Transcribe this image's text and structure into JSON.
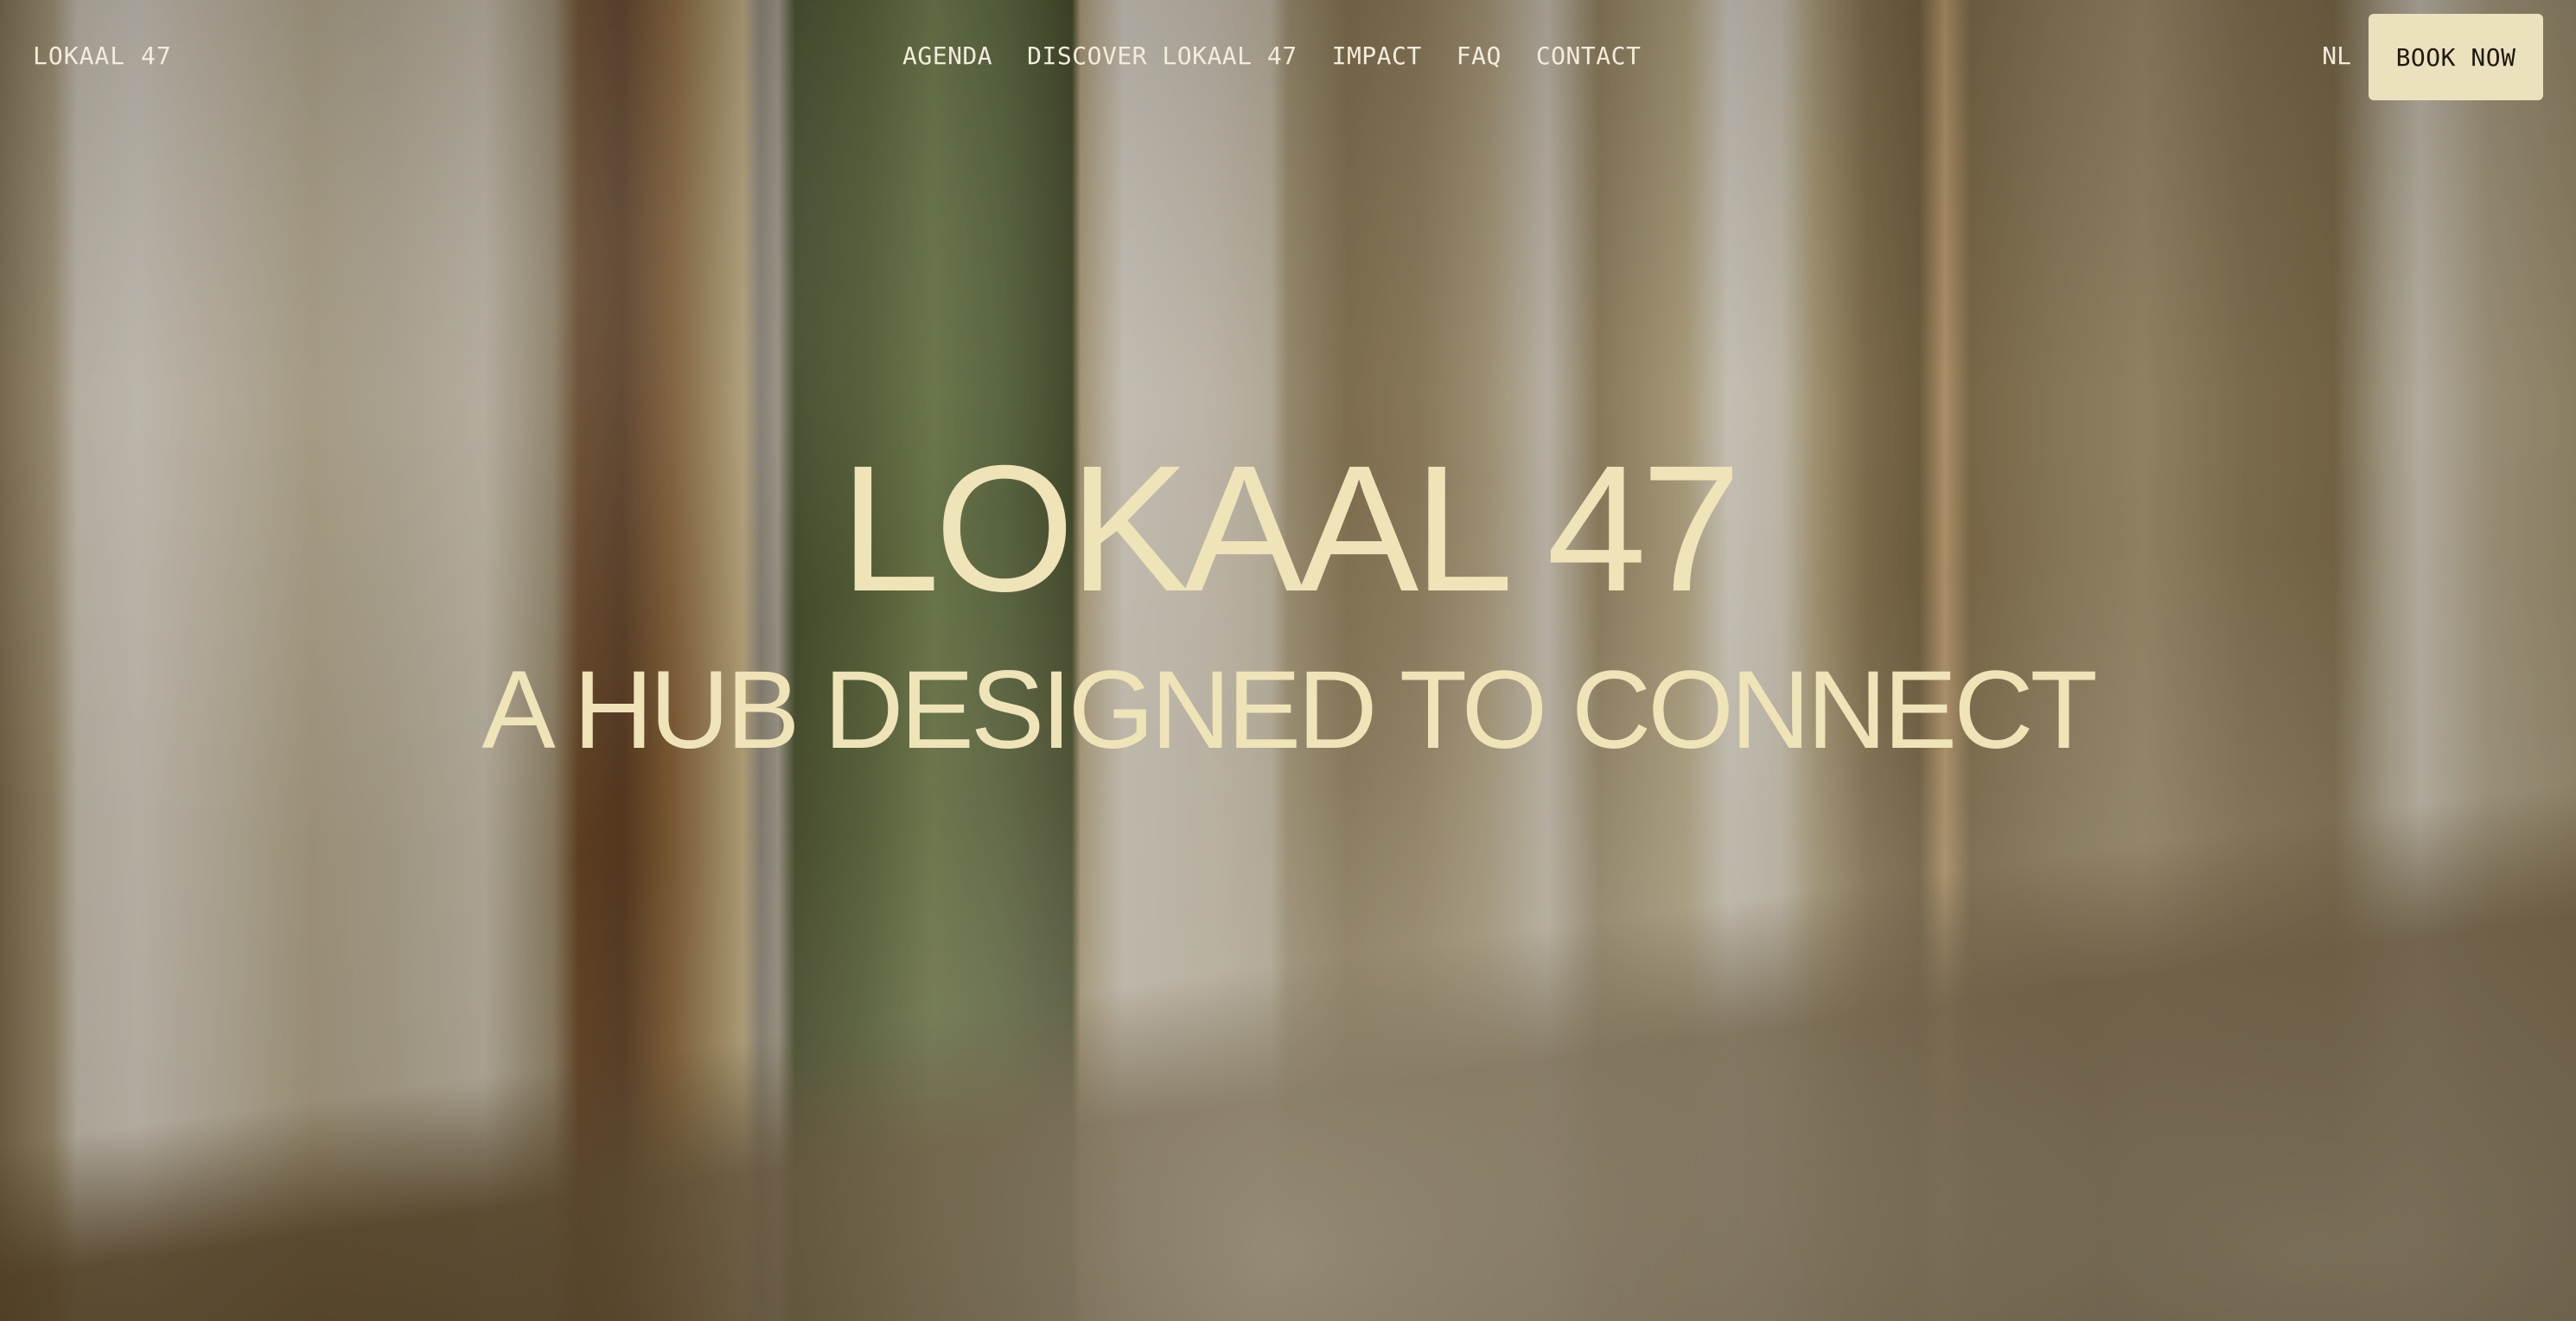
{
  "nav": {
    "brand": "LOKAAL 47",
    "items": [
      {
        "label": "AGENDA"
      },
      {
        "label": "DISCOVER LOKAAL 47"
      },
      {
        "label": "IMPACT"
      },
      {
        "label": "FAQ"
      },
      {
        "label": "CONTACT"
      }
    ],
    "language": "NL",
    "cta": "BOOK NOW"
  },
  "hero": {
    "title": "LOKAAL 47",
    "subtitle": "A HUB DESIGNED TO CONNECT"
  },
  "colors": {
    "accent": "#ece1bd",
    "headline": "#efe3b8",
    "nav_text": "#f3ecdc"
  }
}
